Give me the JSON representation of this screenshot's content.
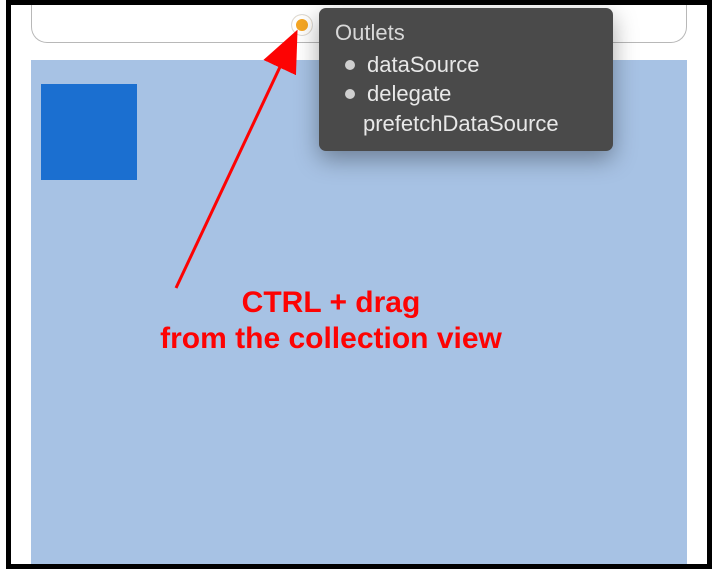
{
  "popover": {
    "title": "Outlets",
    "items": [
      {
        "label": "dataSource",
        "connected": true
      },
      {
        "label": "delegate",
        "connected": true
      },
      {
        "label": "prefetchDataSource",
        "connected": false
      }
    ]
  },
  "annotation": {
    "line1": "CTRL + drag",
    "line2": "from the collection view"
  },
  "colors": {
    "collection_bg": "#a7c2e4",
    "cell_bg": "#1b6fd0",
    "annotation": "#fd0303",
    "anchor": "#f5a623",
    "popover_bg": "#4a4a4a"
  }
}
